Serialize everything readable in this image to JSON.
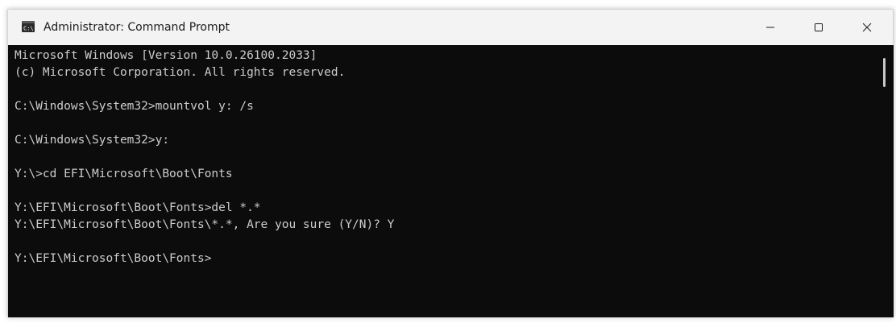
{
  "window": {
    "title": "Administrator: Command Prompt",
    "icon": "command-prompt-icon"
  },
  "titlebar_buttons": {
    "minimize": "minimize-icon",
    "maximize": "maximize-icon",
    "close": "close-icon"
  },
  "colors": {
    "console_background": "#0c0c0c",
    "console_text": "#cccccc",
    "titlebar_background": "#f3f3f3"
  },
  "console": {
    "lines": [
      "Microsoft Windows [Version 10.0.26100.2033]",
      "(c) Microsoft Corporation. All rights reserved.",
      "",
      "C:\\Windows\\System32>mountvol y: /s",
      "",
      "C:\\Windows\\System32>y:",
      "",
      "Y:\\>cd EFI\\Microsoft\\Boot\\Fonts",
      "",
      "Y:\\EFI\\Microsoft\\Boot\\Fonts>del *.*",
      "Y:\\EFI\\Microsoft\\Boot\\Fonts\\*.*, Are you sure (Y/N)? Y",
      "",
      "Y:\\EFI\\Microsoft\\Boot\\Fonts>"
    ]
  }
}
